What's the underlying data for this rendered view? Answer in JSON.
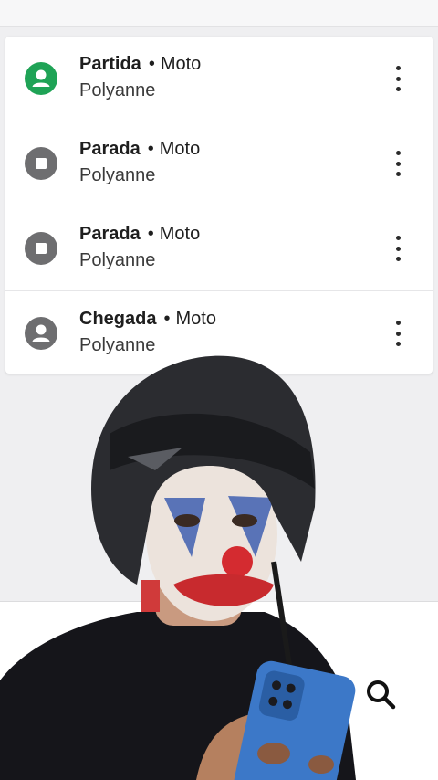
{
  "stops": [
    {
      "status": "Partida",
      "vehicle": "Moto",
      "name": "Polyanne",
      "icon": "person-icon",
      "color": "#1fa356"
    },
    {
      "status": "Parada",
      "vehicle": "Moto",
      "name": "Polyanne",
      "icon": "stop-icon",
      "color": "#6e6e70"
    },
    {
      "status": "Parada",
      "vehicle": "Moto",
      "name": "Polyanne",
      "icon": "stop-icon",
      "color": "#6e6e70"
    },
    {
      "status": "Chegada",
      "vehicle": "Moto",
      "name": "Polyanne",
      "icon": "person-icon",
      "color": "#6e6e70"
    }
  ],
  "separator": "•",
  "colors": {
    "background": "#efeff1",
    "card": "#ffffff",
    "accent_green": "#1fa356",
    "grey_icon": "#6e6e70"
  }
}
